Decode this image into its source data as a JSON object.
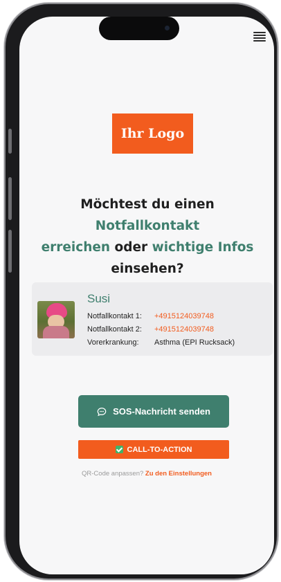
{
  "header": {
    "menu_icon": "hamburger-menu-icon"
  },
  "logo": {
    "text": "Ihr Logo",
    "color": "#f25c1e"
  },
  "headline": {
    "part1": "Möchtest du einen ",
    "highlight1": "Notfallkontakt",
    "part2": " ",
    "highlight2": "erreichen",
    "part3": " oder ",
    "highlight3": "wichtige Infos",
    "part4": " einsehen?",
    "accent_color": "#3f7f6e"
  },
  "profile": {
    "name": "Susi",
    "rows": [
      {
        "label": "Notfallkontakt 1:",
        "value": "+4915124039748"
      },
      {
        "label": "Notfallkontakt 2:",
        "value": "+4915124039748"
      },
      {
        "label": "Vorerkrankung:",
        "value": "Asthma (EPI Rucksack)"
      }
    ]
  },
  "actions": {
    "sos_label": "SOS-Nachricht senden",
    "sos_icon": "chat-bubble-icon",
    "cta_label": "CALL-TO-ACTION",
    "cta_icon": "checkbox-checked-icon"
  },
  "footer": {
    "prompt": "QR-Code anpassen?",
    "link": "Zu den Einstellungen"
  }
}
